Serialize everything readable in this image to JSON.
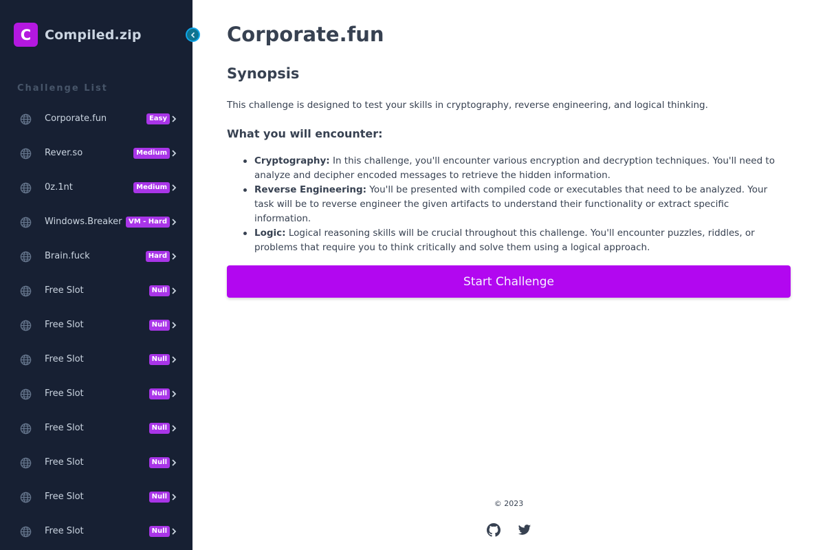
{
  "sidebar": {
    "brand_letter": "C",
    "brand_name": "Compiled.zip",
    "section_title": "Challenge List",
    "items": [
      {
        "label": "Corporate.fun",
        "badge": "Easy"
      },
      {
        "label": "Rever.so",
        "badge": "Medium"
      },
      {
        "label": "0z.1nt",
        "badge": "Medium"
      },
      {
        "label": "Windows.Breaker",
        "badge": "VM - Hard"
      },
      {
        "label": "Brain.fuck",
        "badge": "Hard"
      },
      {
        "label": "Free Slot",
        "badge": "Null"
      },
      {
        "label": "Free Slot",
        "badge": "Null"
      },
      {
        "label": "Free Slot",
        "badge": "Null"
      },
      {
        "label": "Free Slot",
        "badge": "Null"
      },
      {
        "label": "Free Slot",
        "badge": "Null"
      },
      {
        "label": "Free Slot",
        "badge": "Null"
      },
      {
        "label": "Free Slot",
        "badge": "Null"
      },
      {
        "label": "Free Slot",
        "badge": "Null"
      }
    ],
    "item_icon": "globe-icon"
  },
  "main": {
    "title": "Corporate.fun",
    "synopsis_heading": "Synopsis",
    "synopsis_text": "This challenge is designed to test your skills in cryptography, reverse engineering, and logical thinking.",
    "encounter_heading": "What you will encounter:",
    "encounters": [
      {
        "term": "Cryptography:",
        "line1": "In this challenge, you'll encounter various encryption and decryption techniques. You'll need to",
        "line2": "analyze and decipher encoded messages to retrieve the hidden information.",
        "line3": ""
      },
      {
        "term": "Reverse Engineering:",
        "line1": "You'll be presented with compiled code or executables that need to be analyzed. Your",
        "line2": "task will be to reverse engineer the given artifacts to understand their functionality or extract specific",
        "line3": "information."
      },
      {
        "term": "Logic:",
        "line1": "Logical reasoning skills will be crucial throughout this challenge. You'll encounter puzzles, riddles, or",
        "line2": "problems that require you to think critically and solve them using a logical approach.",
        "line3": ""
      }
    ],
    "start_button": "Start Challenge"
  },
  "footer": {
    "copyright": "© 2023",
    "icons": [
      "github-icon",
      "twitter-icon"
    ]
  },
  "colors": {
    "sidebar_bg": "#172033",
    "accent": "#b207f0",
    "badge": "#a935e8",
    "toggle": "#0e7490"
  }
}
